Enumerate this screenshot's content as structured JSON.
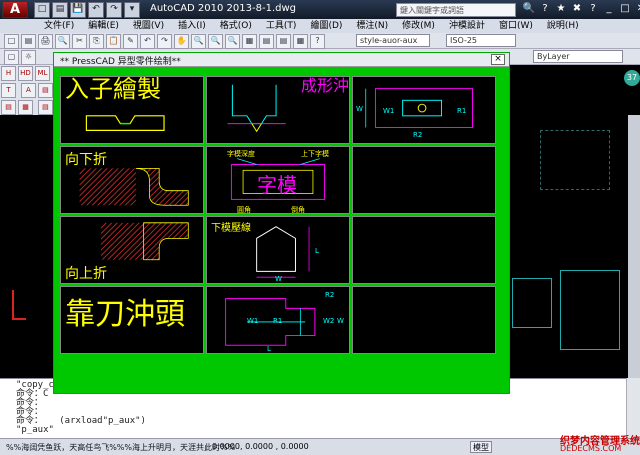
{
  "window": {
    "title": "AutoCAD 2010    2013-8-1.dwg",
    "search_placeholder": "鍵入關鍵字或詞語",
    "logo": "A"
  },
  "quick_access": [
    "□",
    "▤",
    "💾",
    "↶",
    "↷",
    "▾"
  ],
  "title_icons": [
    "🔍",
    "?",
    "★",
    "✖",
    "?",
    "_",
    "□",
    "✕"
  ],
  "menu": [
    "文件(F)",
    "編輯(E)",
    "視圖(V)",
    "插入(I)",
    "格式(O)",
    "工具(T)",
    "繪圖(D)",
    "標注(N)",
    "修改(M)",
    "沖模設計",
    "窗口(W)",
    "說明(H)"
  ],
  "toolbar1": {
    "icons": [
      "□",
      "▤",
      "🖨",
      "🔍",
      "✂",
      "⎘",
      "📋",
      "✎",
      "↶",
      "↷",
      "✋",
      "🔍",
      "🔍",
      "🔍",
      "▦",
      "▤",
      "▤",
      "▦",
      "?"
    ],
    "style_combo": "style-auor-aux",
    "iso_combo": "ISO-25"
  },
  "toolbar2": {
    "layer_combo": "ByLayer"
  },
  "left_tools": [
    "H",
    "HD",
    "ML",
    "T",
    "A",
    "▤",
    "▤",
    "▦",
    "▤",
    "◆",
    "▤",
    "▤"
  ],
  "circle_badge": "37",
  "dialog": {
    "title": "** PressCAD  异型零件绘制**",
    "close": "×",
    "cells": [
      {
        "text": "入子繪製"
      },
      {
        "text": "成形沖頭"
      },
      {
        "labels": [
          "W",
          "W1",
          "R1",
          "R2"
        ]
      },
      {
        "text": "向下折"
      },
      {
        "labels": [
          "字模深度",
          "上下字模"
        ],
        "center": "字模",
        "bottom": [
          "圓角",
          "倒角"
        ]
      },
      {
        "text": ""
      },
      {
        "text": "向上折"
      },
      {
        "center": "下模壓線",
        "labels": [
          "L",
          "W"
        ]
      },
      {
        "text": ""
      },
      {
        "text": "靠刀沖頭"
      },
      {
        "labels": [
          "R2",
          "W1",
          "R1",
          "W",
          "L",
          "W2"
        ]
      },
      {
        "text": ""
      }
    ]
  },
  "command": {
    "lines": [
      "\"copy_cp\"",
      "命令：C",
      "命令：",
      "命令：",
      "命令：   (arxload\"p_aux\")",
      "\"p_aux\""
    ]
  },
  "status": {
    "text": "%%海阔凭鱼跃，天高任鸟飞%%%海上升明月，天涯共此时%%",
    "coords": "0.0000,  0.0000  ,  0.0000",
    "model": "模型",
    "watermark": "织梦内容管理系统",
    "watermark_url": "DEDECMS.COM"
  }
}
